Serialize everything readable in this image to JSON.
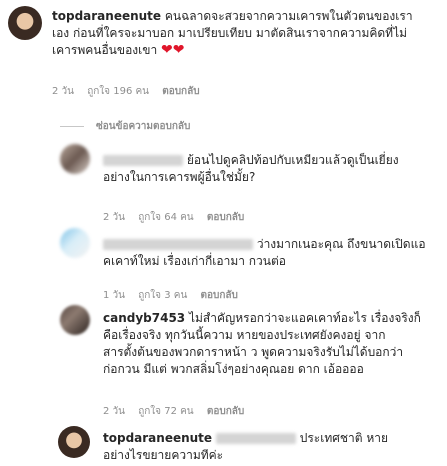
{
  "main_comment": {
    "username": "topdaraneenute",
    "lines": [
      "คนฉลาดจะสวยจากความเคารพในตัวตนของเรา",
      "เอง ก่อนที่ใครจะมาบอก มาเปรียบเทียบ มาตัดสินเราจากความคิดที่ไม่",
      "เคารพคนอื่นของเขา"
    ],
    "time": "2 วัน",
    "likes": "ถูกใจ 196 คน",
    "reply_label": "ตอบกลับ",
    "heart_icon": "heart-icon"
  },
  "hide_replies_label": "ซ่อนข้อความตอบกลับ",
  "replies": [
    {
      "lines": [
        "ย้อนไปดูคลิปท้อปกับเหมียวแล้วดูเป็นเยี่ยง",
        "อย่างในการเคารพผู้อื่นใช่มั้ย?"
      ],
      "time": "2 วัน",
      "likes": "ถูกใจ 64 คน",
      "reply_label": "ตอบกลับ"
    },
    {
      "lines": [
        "ว่างมากเนอะคุณ ถึงขนาดเปิดแอ",
        "คเคาท์ใหม่ เรื่องเก่ากี่เอามา กวนต่อ"
      ],
      "time": "1 วัน",
      "likes": "ถูกใจ 3 คน",
      "reply_label": "ตอบกลับ"
    },
    {
      "username": "candyb7453",
      "lines": [
        "ไม่สำคัญหรอกว่าจะแอคเคาท์อะไร เรื่องจริงก็",
        "คือเรื่องจริง ทุกวันนี้ความ  หายของประเทศยังคงอยู่ จาก",
        "สารตั้งต้นของพวกดาราหน้า  ว พูดความจริงรับไม่ได้บอกว่า",
        "ก่อกวน มีแต่  พวกสลิ่มโง่ๆอย่างคุณอย  ดาก เอ้ออออ"
      ],
      "time": "2 วัน",
      "likes": "ถูกใจ 72 คน",
      "reply_label": "ตอบกลับ"
    },
    {
      "username": "topdaraneenute",
      "lines": [
        "ประเทศชาติ  หาย",
        "อย่างไรขยายความทีค่ะ"
      ]
    }
  ]
}
